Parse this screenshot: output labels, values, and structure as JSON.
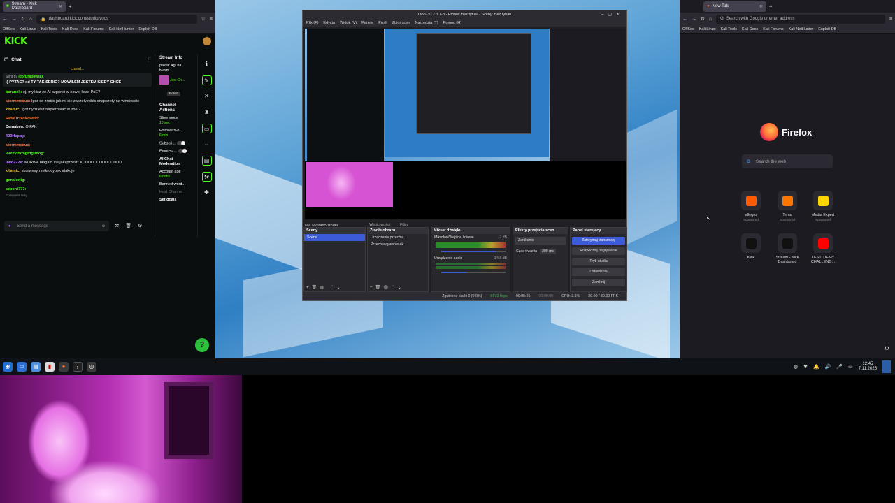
{
  "kick_browser": {
    "tab_title": "Stream - Kick Dashboard",
    "url": "dashboard.kick.com/studio/vods",
    "bookmarks": [
      "OffSec",
      "Kali Linux",
      "Kali Tools",
      "Kali Docs",
      "Kali Forums",
      "Kali NetHunter",
      "Exploit-DB"
    ],
    "logo": "KICK",
    "chat": {
      "title": "Chat",
      "system_line": "czarod...",
      "pinned_by_label": "Sent by",
      "pinned_user": "IgorDrabowski",
      "pinned_text": ":) PYTAC? xd TY TAK SERIO? MÓWIŁEM JESTEM KIEDY CHCE",
      "messages": [
        {
          "user": "baranek:",
          "color": "#53fc18",
          "text": "ej, myślisz że AI szponci w nowej łidze PoE?"
        },
        {
          "user": "stormmeduc:",
          "color": "#ff7a3d",
          "text": "Igor co zrobic jak mi sie zaczeły robic snapszoty na windowsie"
        },
        {
          "user": "xYamic:",
          "color": "#e8c12a",
          "text": "Igor bydziesz napierdalac w poe ?"
        },
        {
          "user": "RafalTrzaskowski:",
          "color": "#ff7a3d",
          "text": ""
        },
        {
          "user": "Demaken:",
          "color": "#ffffff",
          "text": "O FAK"
        },
        {
          "user": "420Happy:",
          "color": "#b37bff",
          "text": ""
        },
        {
          "user": "stormmeduc:",
          "color": "#ff7a3d",
          "text": ""
        },
        {
          "user": "vvxxvfddfjgfdgfdfog:",
          "color": "#53fc18",
          "text": ""
        },
        {
          "user": "uwq222e:",
          "color": "#b37bff",
          "text": "KURWA błagam cie jaki przestr XDDDDDDDDDDDDDD"
        },
        {
          "user": "xYamic:",
          "color": "#e8c12a",
          "text": "skurwesyn mikrocypek atakuje"
        },
        {
          "user": "gensionig:",
          "color": "#53fc18",
          "text": ""
        },
        {
          "user": "szpont777:",
          "color": "#53fc18",
          "text": ""
        }
      ],
      "followers_only": "Followers only",
      "send_placeholder": "Send a message"
    },
    "side": {
      "stream_info": "Stream Info",
      "stream_title": "pasek Agi na twoim...",
      "just_chat": "Just Ch...",
      "language": "Polish",
      "channel_actions": "Channel Actions",
      "slow_mode": "Slow mode",
      "slow_mode_value": "10 sec",
      "followers_only": "Followers-o...",
      "followers_value": "6 min",
      "subscribers": "Subscri...",
      "emotes": "Emotes-...",
      "ai_moderation": "AI Chat Moderation",
      "account_age": "Account age",
      "account_value": "6 mths",
      "banned_words": "Banned word...",
      "host_channel": "Host Channel",
      "set_goals": "Set goals"
    }
  },
  "obs": {
    "title": "OBS 30.2.3.1-3 - Profile: Bez tytułu - Sceny: Bez tytułu",
    "menu": [
      "Plik (F)",
      "Edycja",
      "Widok (V)",
      "Panele",
      "Profil",
      "Zbiór scen",
      "Narzędzia (T)",
      "Pomoc (H)"
    ],
    "no_source": "Nie wybrano źródła",
    "properties": "Właściwości",
    "filters": "Filtry",
    "docks": {
      "scenes": {
        "title": "Sceny",
        "items": [
          "Scena"
        ]
      },
      "sources": {
        "title": "Źródła obrazu",
        "items": [
          "Urządzenie przechw...",
          "Przechwytywanie ek..."
        ]
      },
      "mixer": {
        "title": "Mikser dźwięku",
        "ch1": "Mikrofon/Wejście liniowe",
        "ch1_db": "-7 dB",
        "ch2": "Urządzenie audio",
        "ch2_db": "-34.8 dB"
      },
      "transitions": {
        "title": "Efekty przejścia scen",
        "type": "Zanikanie",
        "duration_label": "Czas trwania",
        "duration": "300 ms"
      },
      "controls": {
        "title": "Panel sterujący",
        "buttons": [
          "Zatrzymaj transmisję",
          "Rozpocznij nagrywanie",
          "Tryb studia",
          "Ustawienia",
          "Zamknij"
        ]
      }
    },
    "status": {
      "dropped": "Zgubione klatki 0 (0.0%)",
      "bitrate": "8673 kbps",
      "live": "00:05:21",
      "rec": "00:00:00",
      "cpu": "CPU: 3.6%",
      "fps": "30.00 / 30.00 FPS"
    }
  },
  "firefox": {
    "tab_title": "New Tab",
    "url_placeholder": "Search with Google or enter address",
    "bookmarks": [
      "OffSec",
      "Kali Linux",
      "Kali Tools",
      "Kali Docs",
      "Kali Forums",
      "Kali NetHunter",
      "Exploit-DB"
    ],
    "brand": "Firefox",
    "search_placeholder": "Search the web",
    "shortcuts": [
      {
        "label": "allegro",
        "sub": "Sponsored",
        "color": "#ff5a00"
      },
      {
        "label": "Temu",
        "sub": "Sponsored",
        "color": "#fb7701"
      },
      {
        "label": "Media Expert",
        "sub": "Sponsored",
        "color": "#ffd600"
      },
      {
        "label": "Kick",
        "sub": "",
        "color": "#111111"
      },
      {
        "label": "Stream - Kick Dashboard",
        "sub": "",
        "color": "#111111"
      },
      {
        "label": "TESTUJEMY CHALLENG...",
        "sub": "",
        "color": "#ff0000"
      }
    ]
  },
  "taskbar": {
    "time": "12:45",
    "date": "7.11.2025"
  },
  "colors": {
    "kick_green": "#53fc18",
    "obs_blue": "#3c5bd8"
  }
}
